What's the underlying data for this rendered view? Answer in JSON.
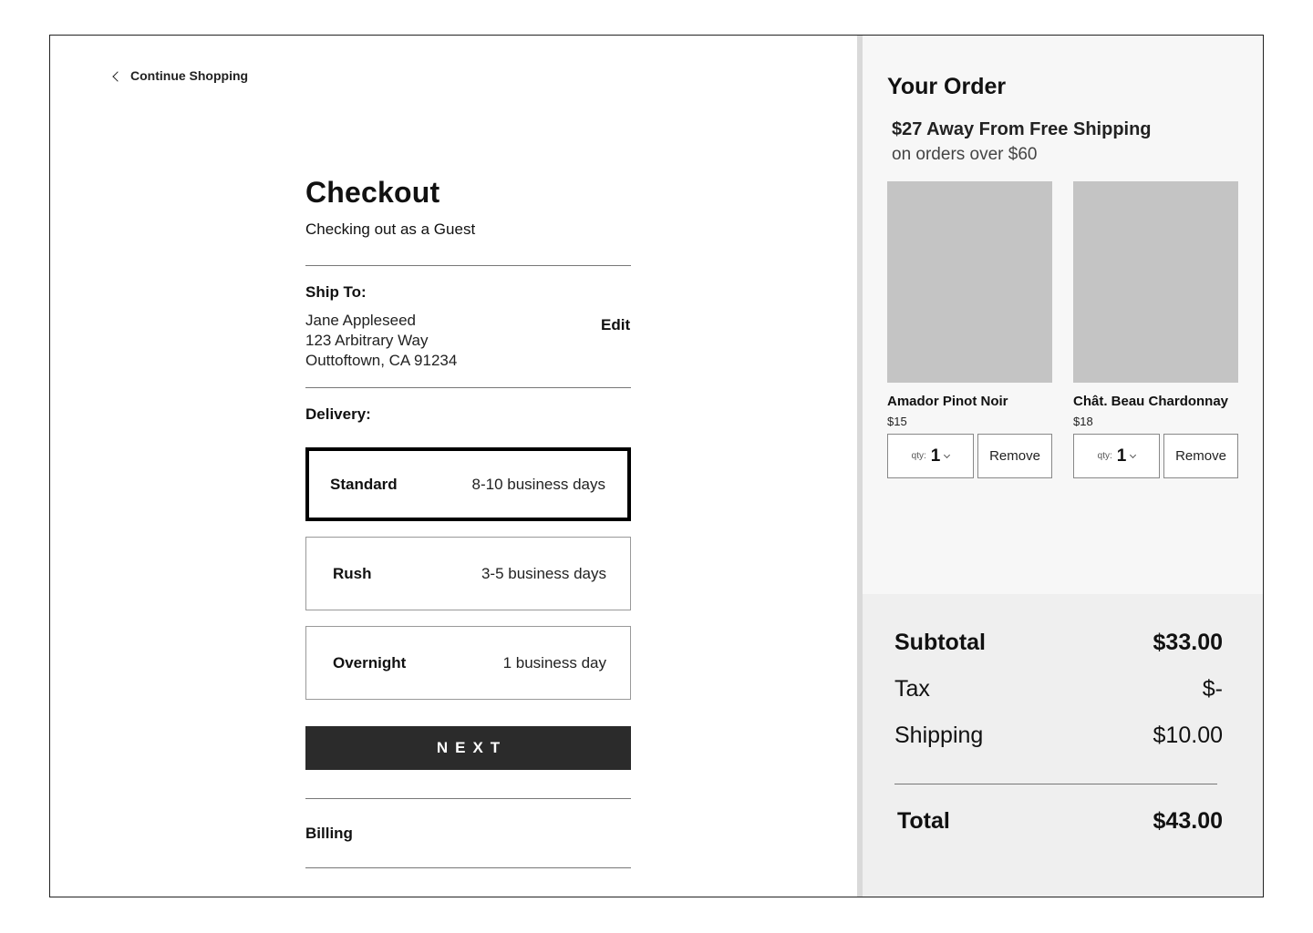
{
  "nav": {
    "back_label": "Continue Shopping"
  },
  "checkout": {
    "title": "Checkout",
    "subtitle": "Checking out as a Guest",
    "ship_to": {
      "label": "Ship To:",
      "name": "Jane Appleseed",
      "street": "123 Arbitrary Way",
      "city_line": "Outtoftown, CA 91234",
      "edit_label": "Edit"
    },
    "delivery": {
      "label": "Delivery:",
      "options": [
        {
          "name": "Standard",
          "time": "8-10 business days",
          "selected": true
        },
        {
          "name": "Rush",
          "time": "3-5 business days",
          "selected": false
        },
        {
          "name": "Overnight",
          "time": "1 business day",
          "selected": false
        }
      ]
    },
    "next_label": "NEXT",
    "billing_label": "Billing"
  },
  "order": {
    "title": "Your Order",
    "promo_main": "$27 Away From Free Shipping",
    "promo_sub": "on orders over $60",
    "products": [
      {
        "name": "Amador Pinot Noir",
        "price": "$15",
        "qty_label": "qty:",
        "qty": "1",
        "remove_label": "Remove"
      },
      {
        "name": "Chât. Beau Chardonnay",
        "price": "$18",
        "qty_label": "qty:",
        "qty": "1",
        "remove_label": "Remove"
      }
    ],
    "summary": {
      "subtotal_label": "Subtotal",
      "subtotal_value": "$33.00",
      "tax_label": "Tax",
      "tax_value": "$-",
      "shipping_label": "Shipping",
      "shipping_value": "$10.00",
      "total_label": "Total",
      "total_value": "$43.00"
    }
  },
  "colors": {
    "button_bg": "#2b2b2b",
    "panel_bg": "#f7f7f7",
    "totals_bg": "#efefef",
    "image_placeholder": "#c4c4c4",
    "selected_border": "#000000"
  },
  "icons": {
    "back": "chevron-left-icon",
    "qty_dropdown": "chevron-down-icon"
  }
}
